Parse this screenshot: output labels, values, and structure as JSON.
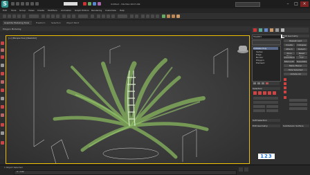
{
  "app": {
    "logo_letter": "S",
    "window_title": "Untitled - 3ds Max 2013 x64"
  },
  "menu": [
    "Edit",
    "Tools",
    "Group",
    "Views",
    "Create",
    "Modifiers",
    "Animation",
    "Graph Editors",
    "Rendering",
    "Customize",
    "Help"
  ],
  "ribbon": {
    "active_tab": "Graphite Modeling Tools",
    "tabs": [
      "Freeform",
      "Selection",
      "Object Paint"
    ],
    "sub_label": "Polygon Modeling"
  },
  "viewport": {
    "label": "[+] [Perspective] [Realistic]"
  },
  "panel": {
    "object_name": "Tree001",
    "modifier_header": "Edit Geometry",
    "list_items": [
      "Editable Poly",
      "Vertex",
      "Edge",
      "Border",
      "Polygon",
      "Element"
    ],
    "section_1": "Selection",
    "section_2": "Soft Selection",
    "section_3": "Edit Geometry",
    "section_4": "Subdivision Surface",
    "btn_1": "Repeat Last",
    "btn_2": "Create",
    "btn_3": "Collapse",
    "btn_4": "Attach",
    "btn_5": "Detach",
    "btn_6": "Slice Plane",
    "btn_7": "Reset Plane",
    "btn_8": "QuickSlice",
    "btn_9": "Cut",
    "btn_10": "MSmooth",
    "btn_11": "Tessellate",
    "btn_12": "Make Planar",
    "btn_13": "Hide Selected",
    "btn_14": "Unhide All"
  },
  "status": {
    "selection_text": "1 Object Selected",
    "frame": "0 / 100"
  },
  "watermark": "123",
  "colors": {
    "viewport_border": "#f0c000",
    "foliage": "#7fa85a",
    "accent_red": "#c44",
    "logo_teal": "#2f8f8a"
  }
}
